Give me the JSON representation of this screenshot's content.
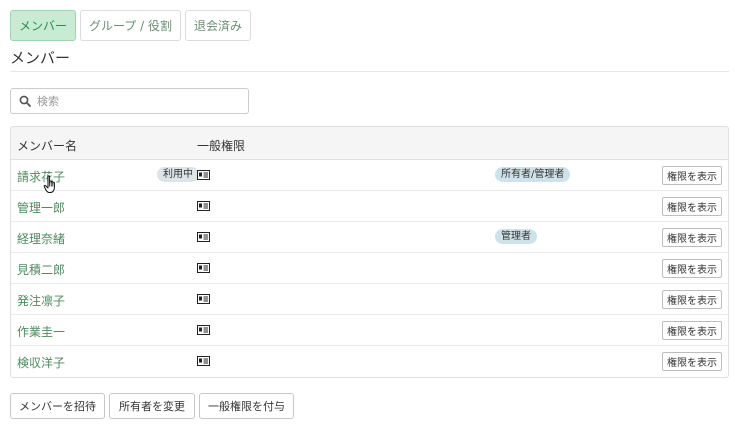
{
  "tabs": [
    {
      "label": "メンバー",
      "active": true
    },
    {
      "label": "グループ / 役割",
      "active": false
    },
    {
      "label": "退会済み",
      "active": false
    }
  ],
  "page_title": "メンバー",
  "search": {
    "placeholder": "検索",
    "icon": "search-icon"
  },
  "table": {
    "headers": {
      "name": "メンバー名",
      "permissions": "一般権限"
    },
    "rows": [
      {
        "name": "請求花子",
        "status": "利用中",
        "role": "所有者/管理者",
        "button": "権限を表示"
      },
      {
        "name": "管理一郎",
        "status": "",
        "role": "",
        "button": "権限を表示"
      },
      {
        "name": "経理奈緒",
        "status": "",
        "role": "管理者",
        "button": "権限を表示"
      },
      {
        "name": "見積二郎",
        "status": "",
        "role": "",
        "button": "権限を表示"
      },
      {
        "name": "発注凛子",
        "status": "",
        "role": "",
        "button": "権限を表示"
      },
      {
        "name": "作業圭一",
        "status": "",
        "role": "",
        "button": "権限を表示"
      },
      {
        "name": "検収洋子",
        "status": "",
        "role": "",
        "button": "権限を表示"
      }
    ]
  },
  "actions": {
    "invite": "メンバーを招待",
    "change_owner": "所有者を変更",
    "grant": "一般権限を付与"
  },
  "colors": {
    "accent": "#2f8a4e",
    "active_tab_bg": "#c7ecd3",
    "link": "#4f8a5f",
    "badge": "#cfe2e9"
  }
}
